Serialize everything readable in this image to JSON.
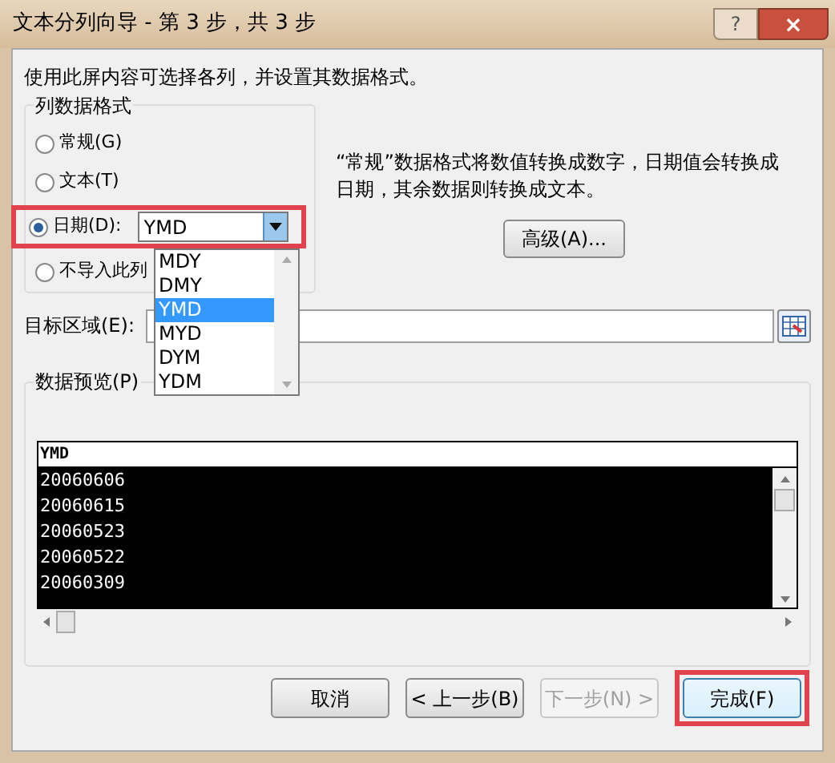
{
  "window": {
    "title": "文本分列向导 - 第 3 步，共 3 步",
    "help": "?",
    "close": "×"
  },
  "instruction": "使用此屏内容可选择各列，并设置其数据格式。",
  "column_format": {
    "label": "列数据格式",
    "options": [
      {
        "label": "常规(G)",
        "selected": false,
        "highlighted": false
      },
      {
        "label": "文本(T)",
        "selected": false,
        "highlighted": false
      },
      {
        "label": "日期(D):",
        "selected": true,
        "highlighted": true
      },
      {
        "label": "不导入此列",
        "selected": false,
        "highlighted": false
      }
    ],
    "date_select": {
      "value": "YMD",
      "expanded": true,
      "options": [
        {
          "label": "MDY",
          "selected": false
        },
        {
          "label": "DMY",
          "selected": false
        },
        {
          "label": "YMD",
          "selected": true
        },
        {
          "label": "MYD",
          "selected": false
        },
        {
          "label": "DYM",
          "selected": false
        },
        {
          "label": "YDM",
          "selected": false
        }
      ]
    }
  },
  "description": "“常规”数据格式将数值转换成数字，日期值会转换成日期，其余数据则转换成文本。",
  "advanced_button": "高级(A)...",
  "target": {
    "label": "目标区域(E):"
  },
  "preview": {
    "label": "数据预览(P)",
    "header": "YMD",
    "rows": [
      "20060606",
      "20060615",
      "20060523",
      "20060522",
      "20060309"
    ]
  },
  "buttons": [
    {
      "label": "取消",
      "disabled": false,
      "highlighted": false
    },
    {
      "label": "< 上一步(B)",
      "disabled": false,
      "highlighted": false
    },
    {
      "label": "下一步(N) >",
      "disabled": true,
      "highlighted": false
    },
    {
      "label": "完成(F)",
      "disabled": false,
      "highlighted": true
    }
  ]
}
